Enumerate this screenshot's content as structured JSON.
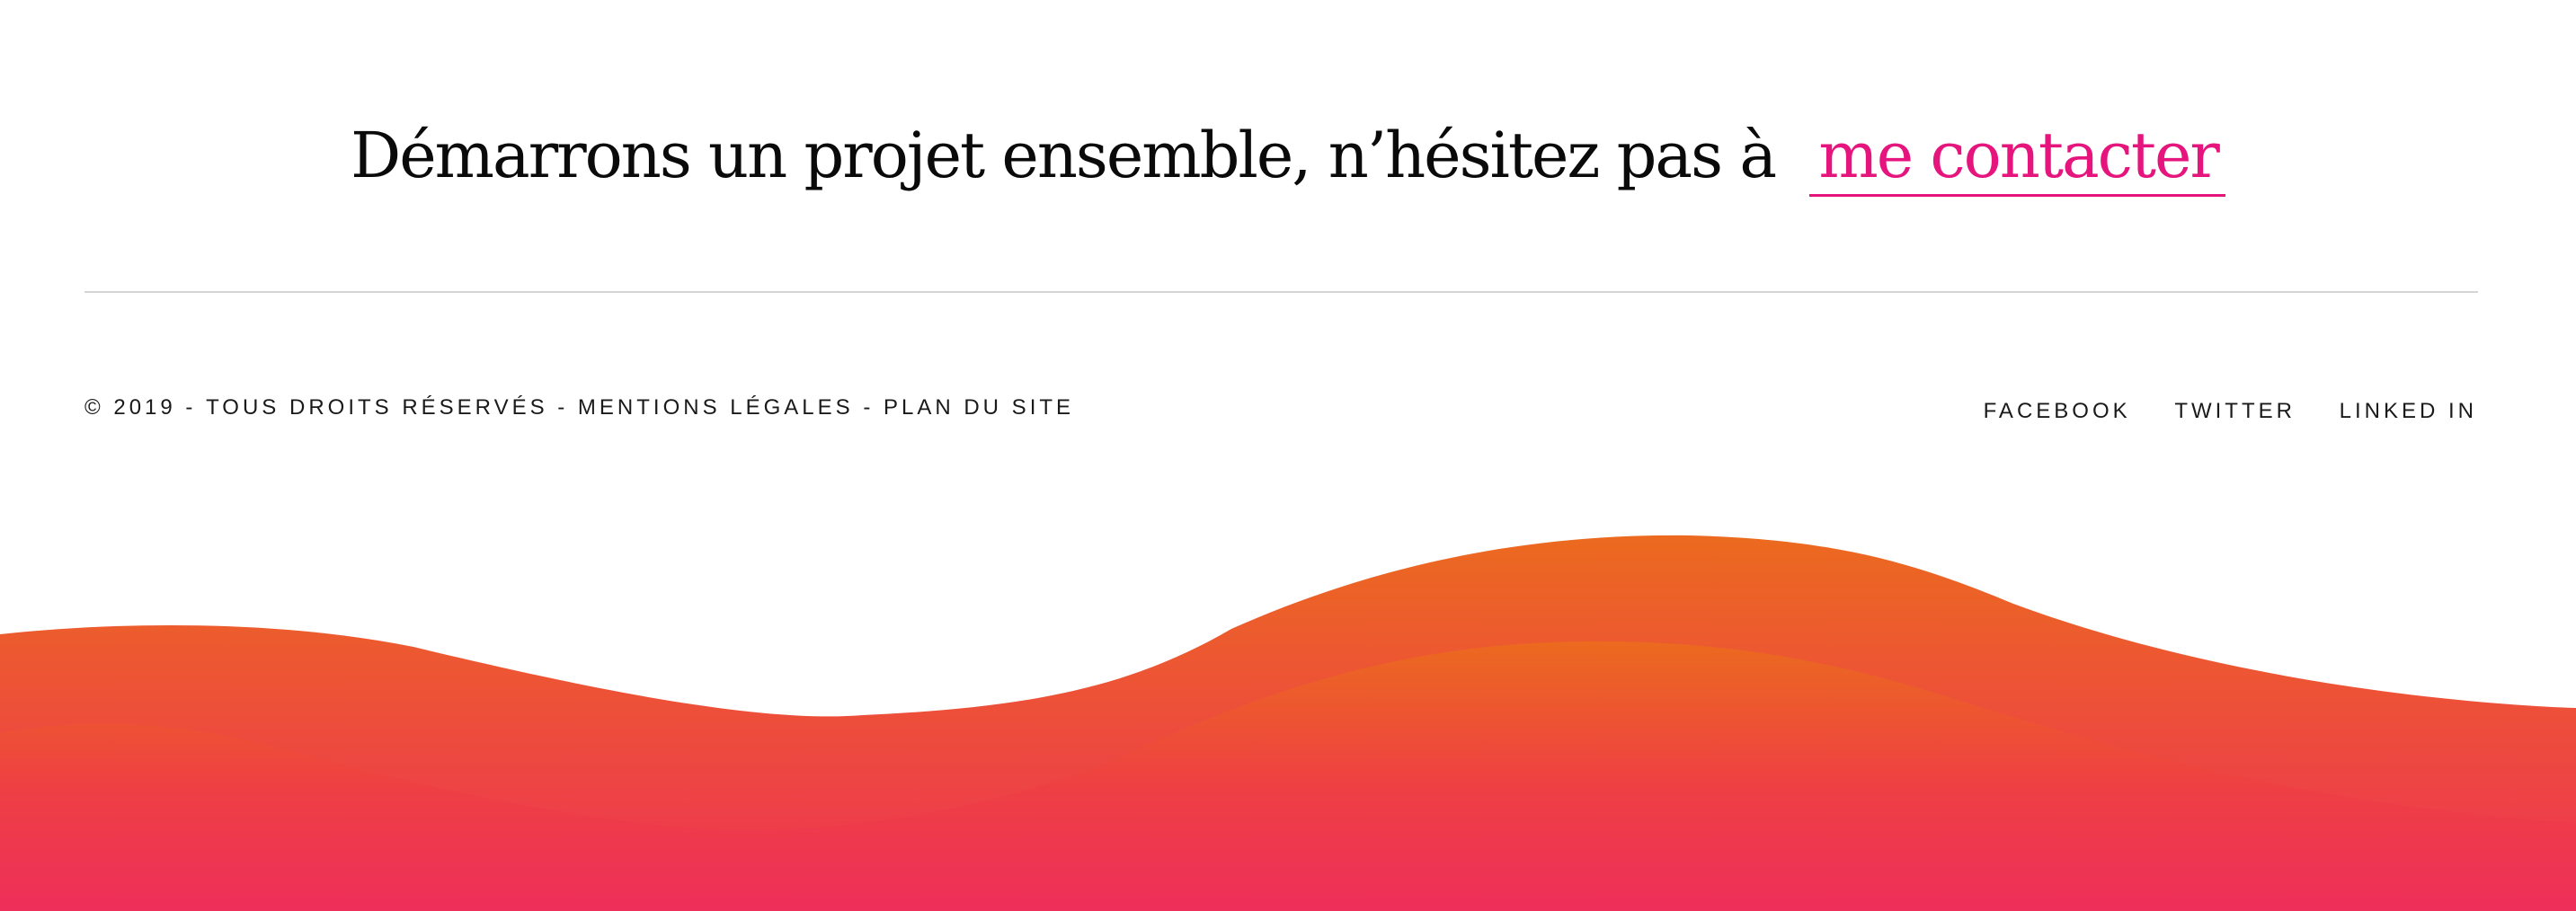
{
  "cta": {
    "text": "Démarrons un projet ensemble, n’hésitez pas à",
    "link_label": "me contacter"
  },
  "footer": {
    "copyright": "© 2019",
    "separator": " - ",
    "rights": "TOUS DROITS RÉSERVÉS",
    "legal": "MENTIONS LÉGALES",
    "sitemap": "PLAN DU SITE",
    "social": [
      {
        "label": "FACEBOOK"
      },
      {
        "label": "TWITTER"
      },
      {
        "label": "LINKED IN"
      }
    ]
  },
  "colors": {
    "accent": "#e6157e",
    "wave_orange": "#ec6a1f",
    "wave_red": "#ee3157"
  }
}
